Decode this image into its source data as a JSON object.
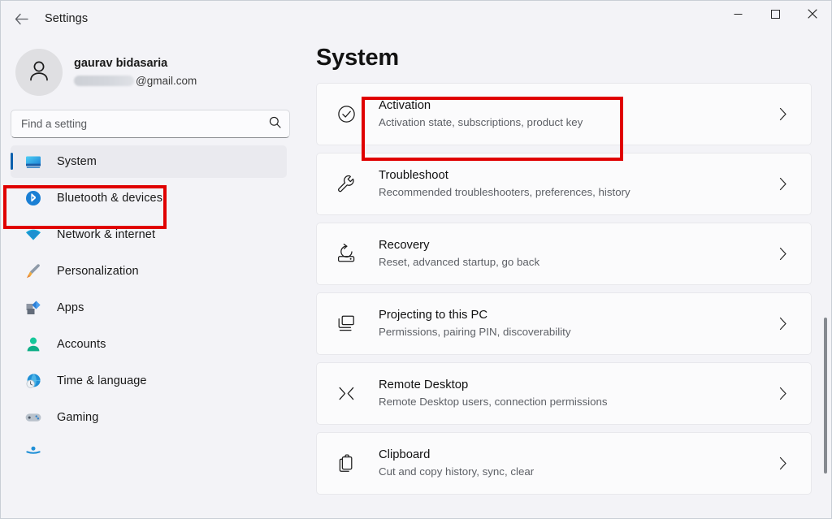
{
  "window": {
    "app_title": "Settings",
    "back_icon": "back-arrow-icon",
    "minimize_label": "Minimize",
    "maximize_label": "Maximize",
    "close_label": "Close"
  },
  "sidebar": {
    "profile": {
      "name": "gaurav bidasaria",
      "email_suffix": "@gmail.com",
      "email_redacted": true,
      "avatar_icon": "person-icon"
    },
    "search": {
      "placeholder": "Find a setting",
      "value": "",
      "icon": "search-icon"
    },
    "items": [
      {
        "label": "System",
        "icon": "monitor-icon",
        "selected": true
      },
      {
        "label": "Bluetooth & devices",
        "icon": "bluetooth-icon",
        "selected": false
      },
      {
        "label": "Network & internet",
        "icon": "wifi-icon",
        "selected": false
      },
      {
        "label": "Personalization",
        "icon": "paintbrush-icon",
        "selected": false
      },
      {
        "label": "Apps",
        "icon": "apps-icon",
        "selected": false
      },
      {
        "label": "Accounts",
        "icon": "account-icon",
        "selected": false
      },
      {
        "label": "Time & language",
        "icon": "clock-globe-icon",
        "selected": false
      },
      {
        "label": "Gaming",
        "icon": "gamepad-icon",
        "selected": false
      },
      {
        "label": "",
        "icon": "accessibility-icon",
        "selected": false
      }
    ]
  },
  "main": {
    "title": "System",
    "cards": [
      {
        "title": "Activation",
        "subtitle": "Activation state, subscriptions, product key",
        "icon": "check-circle-icon",
        "chevron": "chevron-right-icon"
      },
      {
        "title": "Troubleshoot",
        "subtitle": "Recommended troubleshooters, preferences, history",
        "icon": "wrench-icon",
        "chevron": "chevron-right-icon"
      },
      {
        "title": "Recovery",
        "subtitle": "Reset, advanced startup, go back",
        "icon": "recovery-icon",
        "chevron": "chevron-right-icon"
      },
      {
        "title": "Projecting to this PC",
        "subtitle": "Permissions, pairing PIN, discoverability",
        "icon": "projecting-icon",
        "chevron": "chevron-right-icon"
      },
      {
        "title": "Remote Desktop",
        "subtitle": "Remote Desktop users, connection permissions",
        "icon": "remote-desktop-icon",
        "chevron": "chevron-right-icon"
      },
      {
        "title": "Clipboard",
        "subtitle": "Cut and copy history, sync, clear",
        "icon": "clipboard-icon",
        "chevron": "chevron-right-icon"
      }
    ]
  },
  "annotations": {
    "accent_color": "#e00000",
    "boxes": [
      {
        "target": "sidebar-item-system"
      },
      {
        "target": "card-activation"
      }
    ]
  },
  "colors": {
    "window_background": "#f3f3f7",
    "card_background": "#fbfbfc",
    "selected_nav_background": "#eaeaef",
    "nav_accent": "#0c60ad",
    "annotation_red": "#e00000"
  }
}
